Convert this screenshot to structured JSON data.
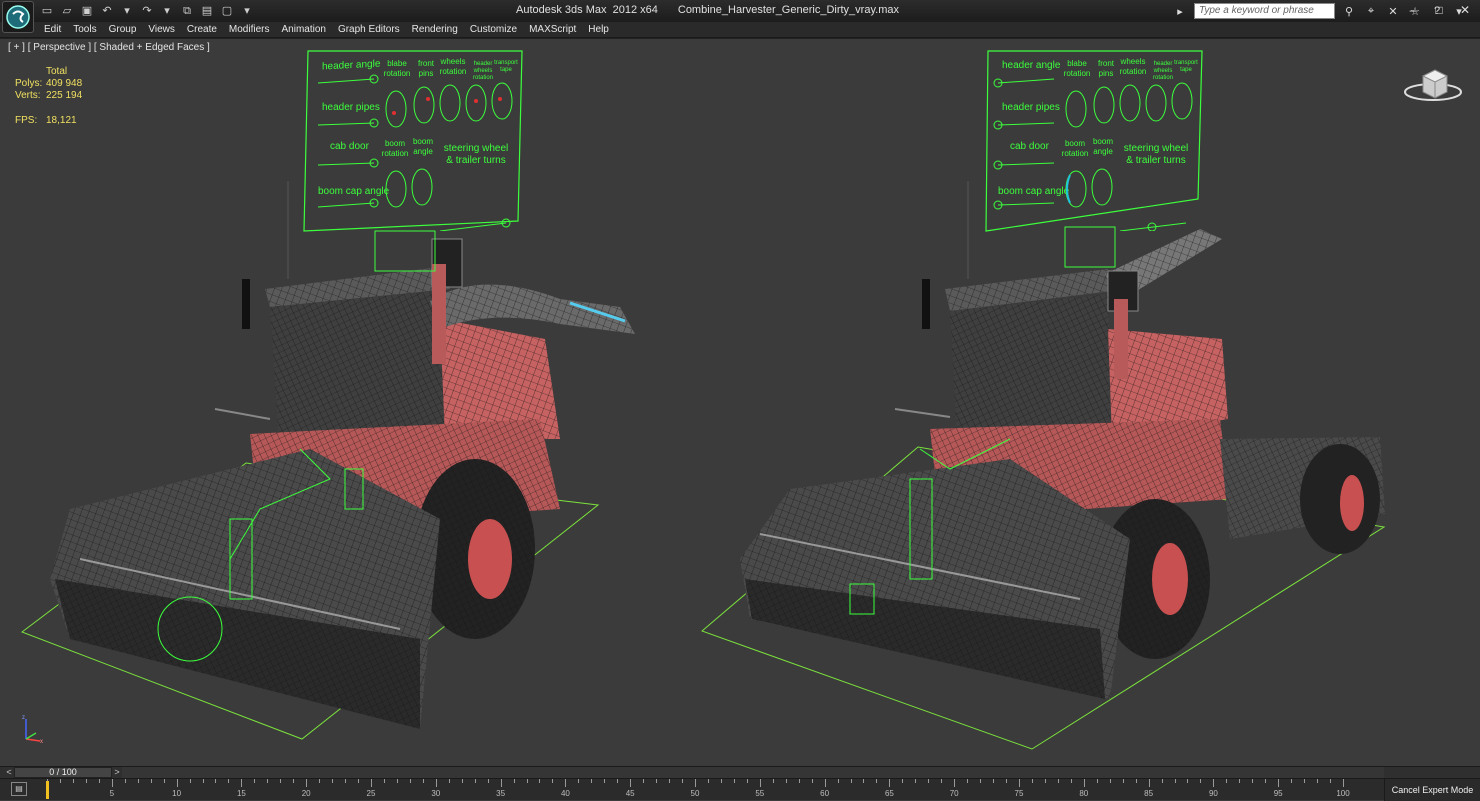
{
  "titlebar": {
    "app_name": "Autodesk 3ds Max  2012 x64",
    "file_name": "Combine_Harvester_Generic_Dirty_vray.max",
    "search_placeholder": "Type a keyword or phrase",
    "qa_icons": [
      "new-file-icon",
      "open-icon",
      "save-icon",
      "undo-icon",
      "redo-icon",
      "hold-icon",
      "dropdown-icon"
    ]
  },
  "menu": {
    "items": [
      "Edit",
      "Tools",
      "Group",
      "Views",
      "Create",
      "Modifiers",
      "Animation",
      "Graph Editors",
      "Rendering",
      "Customize",
      "MAXScript",
      "Help"
    ]
  },
  "viewport": {
    "label": "[ + ] [ Perspective ] [ Shaded + Edged Faces ]",
    "stats": {
      "header": "Total",
      "polys_label": "Polys:",
      "polys_value": "409 948",
      "verts_label": "Verts:",
      "verts_value": "225 194",
      "fps_label": "FPS:",
      "fps_value": "18,121"
    },
    "panels": [
      {
        "header_angle": "header angle",
        "blabe_rotation": "blabe rotation",
        "front_pins": "front pins",
        "wheels_rotation": "wheels rotation",
        "header_wheels_rotation": "header wheels rotation",
        "transport_tape": "transport tape",
        "header_pipes": "header pipes",
        "cab_door": "cab door",
        "boom_rotation": "boom rotation",
        "boom_angle": "boom angle",
        "steering": "steering wheel & trailer turns",
        "boom_cap_angle": "boom cap angle"
      }
    ],
    "colors": {
      "rig": "#3cff3c",
      "body": "#d86a6a",
      "body_dark": "#8a3c3c",
      "frame": "#3a3a3a",
      "ground": "#7be23c"
    }
  },
  "timeslider": {
    "frame_display": "0 / 100",
    "prev_icon": "<",
    "next_icon": ">"
  },
  "trackbar": {
    "ticks": [
      0,
      5,
      10,
      15,
      20,
      25,
      30,
      35,
      40,
      45,
      50,
      55,
      60,
      65,
      70,
      75,
      80,
      85,
      90,
      95,
      100
    ],
    "current_frame": 0,
    "cancel_label": "Cancel Expert Mode"
  }
}
